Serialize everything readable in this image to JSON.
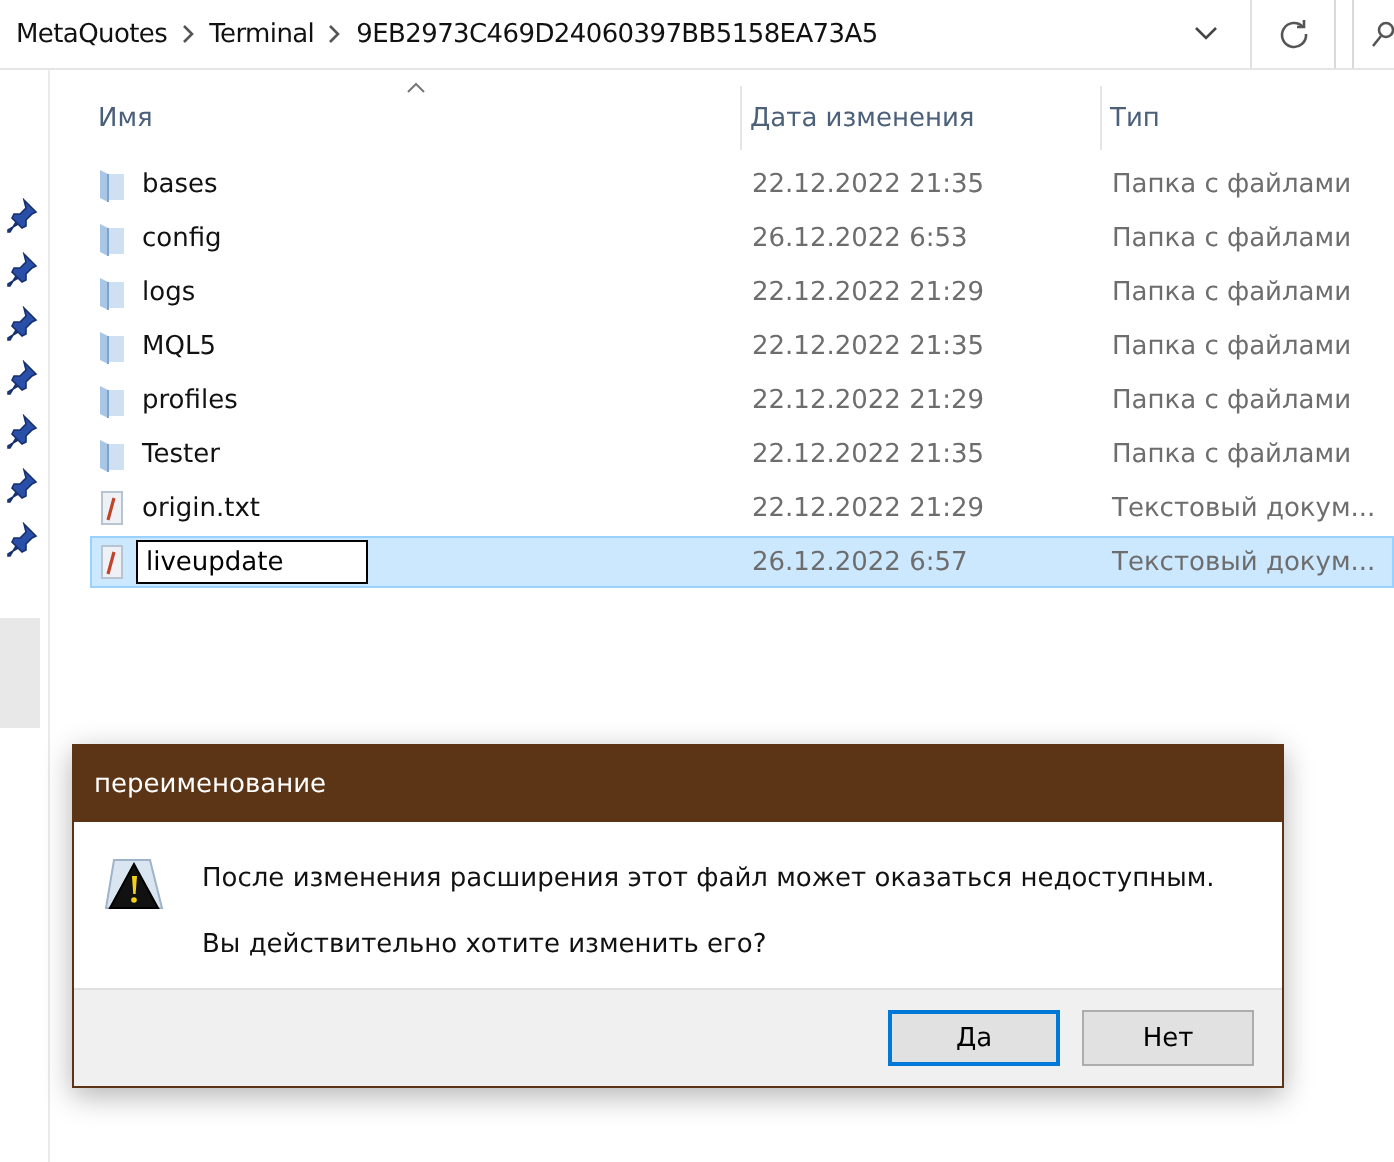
{
  "address_bar": {
    "crumbs": [
      "MetaQuotes",
      "Terminal",
      "9EB2973C469D24060397BB5158EA73A5"
    ]
  },
  "table": {
    "columns": [
      {
        "label": "Имя",
        "sorted": true
      },
      {
        "label": "Дата изменения",
        "sorted": false
      },
      {
        "label": "Тип",
        "sorted": false
      }
    ],
    "rows": [
      {
        "kind": "folder",
        "name": "bases",
        "date": "22.12.2022 21:35",
        "type": "Папка с файлами",
        "selected": false,
        "renaming": false
      },
      {
        "kind": "folder",
        "name": "config",
        "date": "26.12.2022 6:53",
        "type": "Папка с файлами",
        "selected": false,
        "renaming": false
      },
      {
        "kind": "folder",
        "name": "logs",
        "date": "22.12.2022 21:29",
        "type": "Папка с файлами",
        "selected": false,
        "renaming": false
      },
      {
        "kind": "folder",
        "name": "MQL5",
        "date": "22.12.2022 21:35",
        "type": "Папка с файлами",
        "selected": false,
        "renaming": false
      },
      {
        "kind": "folder",
        "name": "profiles",
        "date": "22.12.2022 21:29",
        "type": "Папка с файлами",
        "selected": false,
        "renaming": false
      },
      {
        "kind": "folder",
        "name": "Tester",
        "date": "22.12.2022 21:35",
        "type": "Папка с файлами",
        "selected": false,
        "renaming": false
      },
      {
        "kind": "text",
        "name": "origin.txt",
        "date": "22.12.2022 21:29",
        "type": "Текстовый докум...",
        "selected": false,
        "renaming": false
      },
      {
        "kind": "text",
        "name": "liveupdate",
        "date": "26.12.2022 6:57",
        "type": "Текстовый докум...",
        "selected": true,
        "renaming": true
      }
    ]
  },
  "dialog": {
    "title": "переименование",
    "messages": [
      "После изменения расширения этот файл может оказаться недоступным.",
      "Вы действительно хотите изменить его?"
    ],
    "buttons": [
      {
        "label": "Да",
        "focused": true
      },
      {
        "label": "Нет",
        "focused": false
      }
    ]
  }
}
